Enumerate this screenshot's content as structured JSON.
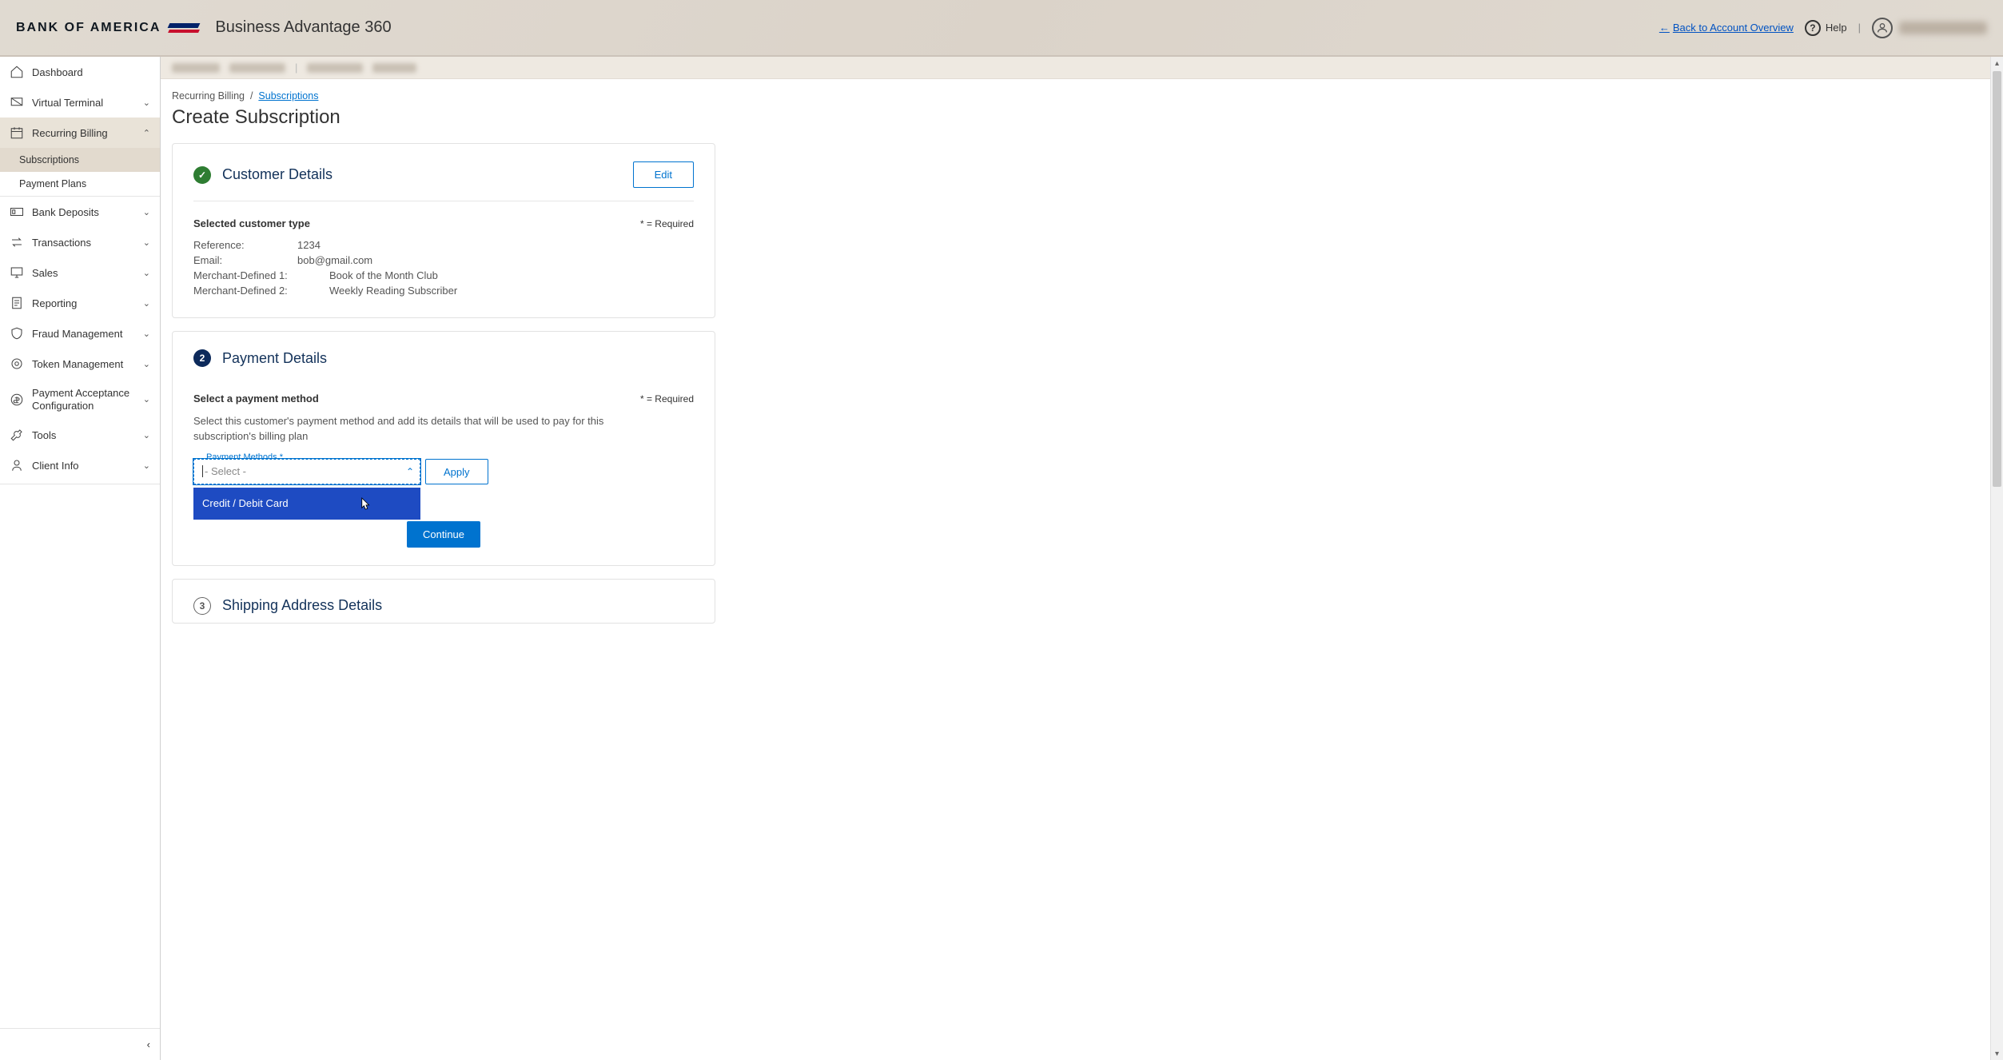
{
  "header": {
    "brand": "BANK OF AMERICA",
    "product": "Business Advantage 360",
    "back_link": "Back to Account Overview",
    "help": "Help"
  },
  "sidebar": {
    "items": [
      {
        "label": "Dashboard",
        "expandable": false
      },
      {
        "label": "Virtual Terminal",
        "expandable": true
      },
      {
        "label": "Recurring Billing",
        "expandable": true,
        "expanded": true,
        "children": [
          {
            "label": "Subscriptions",
            "active": true
          },
          {
            "label": "Payment Plans",
            "active": false
          }
        ]
      },
      {
        "label": "Bank Deposits",
        "expandable": true
      },
      {
        "label": "Transactions",
        "expandable": true
      },
      {
        "label": "Sales",
        "expandable": true
      },
      {
        "label": "Reporting",
        "expandable": true
      },
      {
        "label": "Fraud Management",
        "expandable": true
      },
      {
        "label": "Token Management",
        "expandable": true
      },
      {
        "label": "Payment Acceptance Configuration",
        "expandable": true
      },
      {
        "label": "Tools",
        "expandable": true
      },
      {
        "label": "Client Info",
        "expandable": true
      }
    ]
  },
  "breadcrumb": {
    "root": "Recurring Billing",
    "sep": "/",
    "link": "Subscriptions"
  },
  "page_title": "Create Subscription",
  "required_note": "* = Required",
  "customer": {
    "title": "Customer Details",
    "edit": "Edit",
    "selected_type_label": "Selected customer type",
    "reference_label": "Reference:",
    "reference_value": "1234",
    "email_label": "Email:",
    "email_value": "bob@gmail.com",
    "md1_label": "Merchant-Defined 1:",
    "md1_value": "Book of the Month Club",
    "md2_label": "Merchant-Defined 2:",
    "md2_value": "Weekly Reading Subscriber"
  },
  "payment": {
    "step_num": "2",
    "title": "Payment Details",
    "select_heading": "Select a payment method",
    "help": "Select this customer's payment method and add its details that will be used to pay for this subscription's billing plan",
    "field_label": "Payment Methods *",
    "placeholder": "- Select -",
    "option1": "Credit / Debit Card",
    "apply": "Apply",
    "continue": "Continue"
  },
  "shipping": {
    "step_num": "3",
    "title": "Shipping Address Details"
  }
}
